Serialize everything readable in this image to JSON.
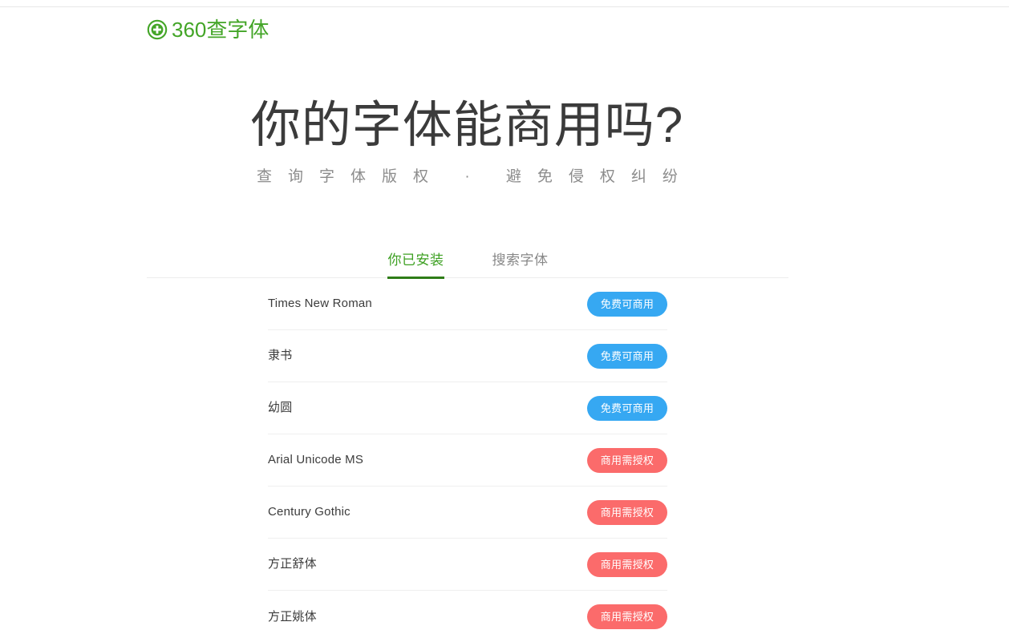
{
  "site": {
    "logo_icon": "circle-plus-icon",
    "logo_text": "360查字体"
  },
  "hero": {
    "title": "你的字体能商用吗?",
    "subtitle": "查询字体版权 · 避免侵权纠纷"
  },
  "tabs": [
    {
      "label": "你已安装",
      "active": true
    },
    {
      "label": "搜索字体",
      "active": false
    }
  ],
  "font_list": [
    {
      "name": "Times New Roman",
      "status": "免费可商用",
      "status_type": "free"
    },
    {
      "name": "隶书",
      "status": "免费可商用",
      "status_type": "free"
    },
    {
      "name": "幼圆",
      "status": "免费可商用",
      "status_type": "free"
    },
    {
      "name": "Arial Unicode MS",
      "status": "商用需授权",
      "status_type": "paid"
    },
    {
      "name": "Century Gothic",
      "status": "商用需授权",
      "status_type": "paid"
    },
    {
      "name": "方正舒体",
      "status": "商用需授权",
      "status_type": "paid"
    },
    {
      "name": "方正姚体",
      "status": "商用需授权",
      "status_type": "paid"
    }
  ],
  "colors": {
    "brand_green": "#43a527",
    "tab_active_green": "#3da022",
    "tab_underline_green": "#2e7d17",
    "badge_free_blue": "#36a8f2",
    "badge_paid_red": "#fb6b6b",
    "title_gray": "#3b3b3b",
    "subtitle_gray": "#8c8c8c",
    "background": "#ffffff"
  }
}
